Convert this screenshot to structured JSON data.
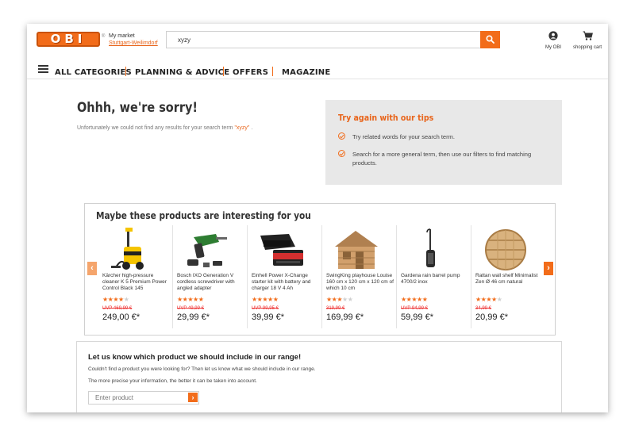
{
  "header": {
    "logo_text": "OBI",
    "registered": "®",
    "market_label": "My market",
    "market_name": "Stuttgart-Weilimdorf",
    "search_value": "xyzy",
    "my_obi_label": "My OBI",
    "cart_label": "shopping cart",
    "icons": {
      "search": "search-icon",
      "user": "user-icon",
      "cart": "cart-icon",
      "menu": "hamburger-icon"
    },
    "accent_color": "#f26c1a"
  },
  "nav": {
    "items": [
      {
        "label": "ALL CATEGORIES"
      },
      {
        "label": "PLANNING & ADVICE"
      },
      {
        "label": "OFFERS"
      },
      {
        "label": "MAGAZINE"
      }
    ]
  },
  "sorry": {
    "title": "Ohhh, we're sorry!",
    "text_before": "Unfortunately we could not find any results for your search term ",
    "term": "\"xyzy\"",
    "text_after": " ."
  },
  "tips": {
    "title": "Try again with our tips",
    "items": [
      "Try related words for your search term.",
      "Search for a more general term, then use our filters to find matching products."
    ]
  },
  "products": {
    "title": "Maybe these products are interesting for you",
    "prev_label": "‹",
    "next_label": "›",
    "items": [
      {
        "name": "Kärcher high-pressure cleaner K 5 Premium Power Control Black 145",
        "rating": 4.5,
        "uvp": "UVP 469,99 €",
        "price": "249,00 €*"
      },
      {
        "name": "Bosch IXO Generation V cordless screwdriver with angled adapter",
        "rating": 5,
        "uvp": "UVP 49,99 €",
        "price": "29,99 €*"
      },
      {
        "name": "Einhell Power X-Change starter kit with battery and charger 18 V 4 Ah",
        "rating": 5,
        "uvp": "UVP 99,95 €",
        "price": "39,99 €*"
      },
      {
        "name": "SwingKing playhouse Louise 160 cm x 120 cm x 120 cm of which 10 cm",
        "rating": 3.5,
        "uvp": "319,99 €",
        "price": "169,99 €*"
      },
      {
        "name": "Gardena rain barrel pump 4700/2 inox",
        "rating": 5,
        "uvp": "UVP 94,99 €",
        "price": "59,99 €*"
      },
      {
        "name": "Rattan wall shelf Minimalist Zen Ø 46 cm natural",
        "rating": 4,
        "uvp": "34,99 €",
        "price": "20,99 €*"
      }
    ]
  },
  "suggest": {
    "title": "Let us know which product we should include in our range!",
    "line1": "Couldn't find a product you were looking for? Then let us know what we should include in our range.",
    "line2": "The more precise your information, the better it can be taken into account.",
    "placeholder": "Enter product",
    "submit_label": "›"
  }
}
